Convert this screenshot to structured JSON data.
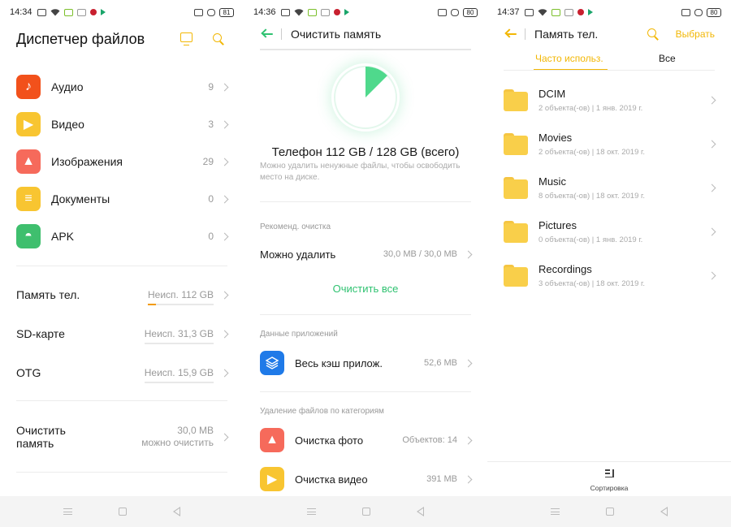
{
  "colors": {
    "accent_yellow": "#f2b705",
    "accent_green": "#2fc271",
    "text": "#1a1a1a",
    "muted": "#999999"
  },
  "screen1": {
    "status": {
      "time": "14:34",
      "battery": "81"
    },
    "title": "Диспетчер файлов",
    "categories": [
      {
        "label": "Аудио",
        "count": "9",
        "color": "#f2511b",
        "icon": "music-note-icon",
        "glyph": "♪"
      },
      {
        "label": "Видео",
        "count": "3",
        "color": "#f8c531",
        "icon": "play-icon",
        "glyph": "▶"
      },
      {
        "label": "Изображения",
        "count": "29",
        "color": "#f66a5b",
        "icon": "image-icon",
        "glyph": "▲"
      },
      {
        "label": "Документы",
        "count": "0",
        "color": "#f8c531",
        "icon": "document-icon",
        "glyph": "≡"
      },
      {
        "label": "APK",
        "count": "0",
        "color": "#3fbf6e",
        "icon": "android-icon",
        "glyph": "◓"
      }
    ],
    "storage": [
      {
        "label": "Память тел.",
        "value": "Неисп. 112 GB",
        "used_fraction": 0.125
      },
      {
        "label": "SD-карте",
        "value": "Неисп. 31,3 GB",
        "used_fraction": 0.0
      },
      {
        "label": "OTG",
        "value": "Неисп. 15,9 GB",
        "used_fraction": 0.0
      }
    ],
    "clean": {
      "label_line1": "Очистить",
      "label_line2": "память",
      "value_line1": "30,0 MB",
      "value_line2": "можно очистить"
    }
  },
  "screen2": {
    "status": {
      "time": "14:36",
      "battery": "80"
    },
    "title": "Очистить память",
    "pie": {
      "used_fraction": 0.125
    },
    "total": "Телефон 112 GB / 128 GB (всего)",
    "note": "Можно удалить ненужные файлы, чтобы освободить место на диске.",
    "recommended": {
      "section": "Рекоменд. очистка",
      "label": "Можно удалить",
      "value": "30,0 MB / 30,0 MB",
      "action": "Очистить все"
    },
    "apps": {
      "section": "Данные приложений",
      "label": "Весь кэш прилож.",
      "value": "52,6 MB",
      "icon": "layers-icon",
      "color": "#1f7ae8"
    },
    "categories": {
      "section": "Удаление файлов по категориям",
      "items": [
        {
          "label": "Очистка фото",
          "value": "Объектов: 14",
          "icon": "image-icon",
          "color": "#f66a5b",
          "glyph": "▲"
        },
        {
          "label": "Очистка видео",
          "value": "391 MB",
          "icon": "play-icon",
          "color": "#f8c531",
          "glyph": "▶"
        }
      ]
    }
  },
  "screen3": {
    "status": {
      "time": "14:37",
      "battery": "80"
    },
    "title": "Память тел.",
    "select": "Выбрать",
    "tabs": [
      {
        "label": "Часто использ.",
        "active": true
      },
      {
        "label": "Все",
        "active": false
      }
    ],
    "folders": [
      {
        "name": "DCIM",
        "meta": "2 объекта(-ов) | 1 янв. 2019 г."
      },
      {
        "name": "Movies",
        "meta": "2 объекта(-ов) | 18 окт. 2019 г."
      },
      {
        "name": "Music",
        "meta": "8 объекта(-ов) | 18 окт. 2019 г."
      },
      {
        "name": "Pictures",
        "meta": "0 объекта(-ов) | 1 янв. 2019 г."
      },
      {
        "name": "Recordings",
        "meta": "3 объекта(-ов) | 18 окт. 2019 г."
      }
    ],
    "sort": "Сортировка"
  }
}
